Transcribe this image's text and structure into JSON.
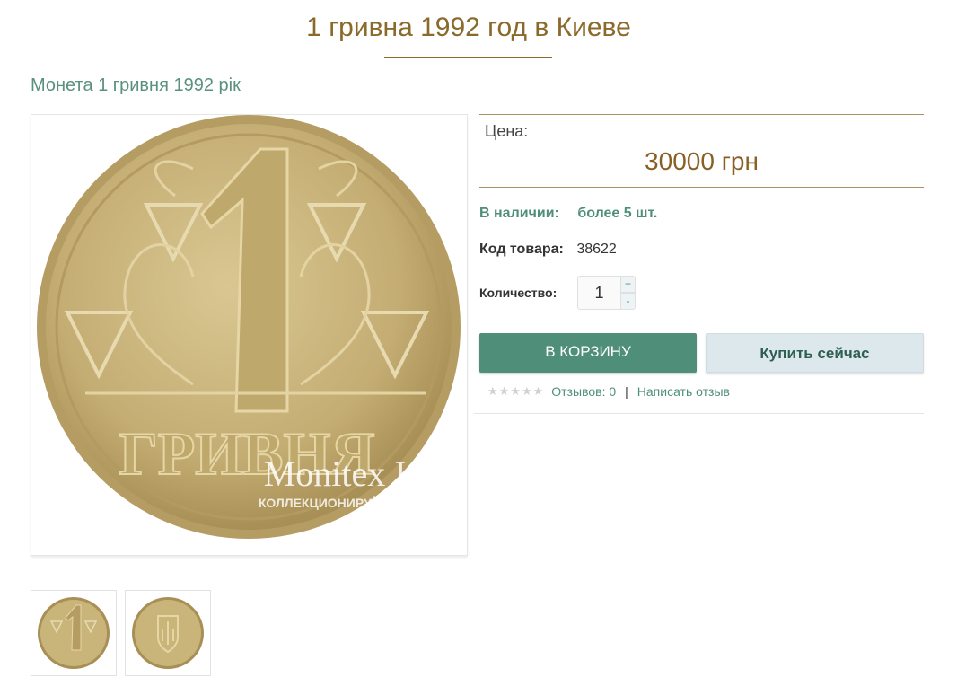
{
  "page": {
    "title": "1 гривна 1992 год в Киеве",
    "subtitle": "Монета 1 гривня 1992 рік"
  },
  "image": {
    "watermark_line1": "Monitex Inc.",
    "watermark_line2": "КОЛЛЕКЦИОНИРУЙТЕ С НАМИ!",
    "coin_denomination": "1",
    "coin_text": "ГРИВНЯ"
  },
  "price": {
    "label": "Цена:",
    "value": "30000 грн"
  },
  "availability": {
    "label": "В наличии:",
    "value": "более 5 шт."
  },
  "product_code": {
    "label": "Код товара:",
    "value": "38622"
  },
  "quantity": {
    "label": "Количество:",
    "value": "1",
    "plus": "+",
    "minus": "-"
  },
  "buttons": {
    "cart": "В КОРЗИНУ",
    "buy_now": "Купить сейчас"
  },
  "reviews": {
    "stars": "★★★★★",
    "count_text": "Отзывов: 0",
    "separator": "|",
    "write_link": "Написать отзыв"
  },
  "colors": {
    "accent_gold": "#8a6a2b",
    "accent_green": "#4f8f7a",
    "coin": "#c9b47a"
  }
}
